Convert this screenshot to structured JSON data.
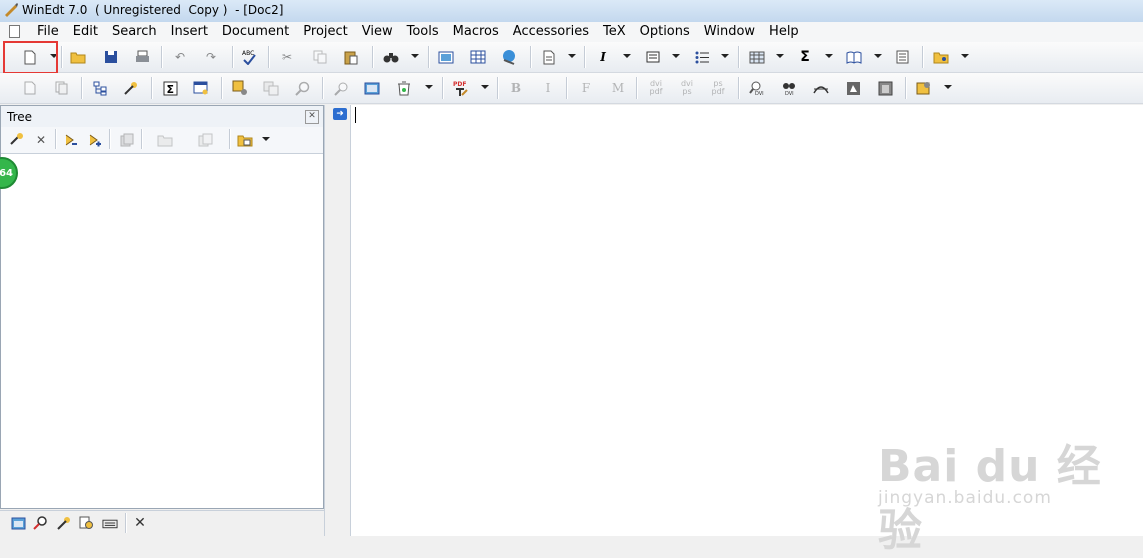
{
  "window": {
    "title": "WinEdt 7.0  ( Unregistered  Copy )  - [Doc2]"
  },
  "menu": [
    "File",
    "Edit",
    "Search",
    "Insert",
    "Document",
    "Project",
    "View",
    "Tools",
    "Macros",
    "Accessories",
    "TeX",
    "Options",
    "Window",
    "Help"
  ],
  "toolbar2": {
    "bold": "B",
    "italic": "I",
    "font_f": "F",
    "font_m": "M",
    "dvi_pdf": "dvi pdf",
    "dvi_ps": "dvi ps",
    "ps_pdf": "ps pdf",
    "pdf": "PDF"
  },
  "tree": {
    "title": "Tree",
    "badge": "64"
  },
  "editor": {
    "content": ""
  },
  "watermark": {
    "brand": "Bai du 经验",
    "url": "jingyan.baidu.com"
  },
  "colors": {
    "highlight": "#e53935",
    "badge": "#34b64b"
  }
}
